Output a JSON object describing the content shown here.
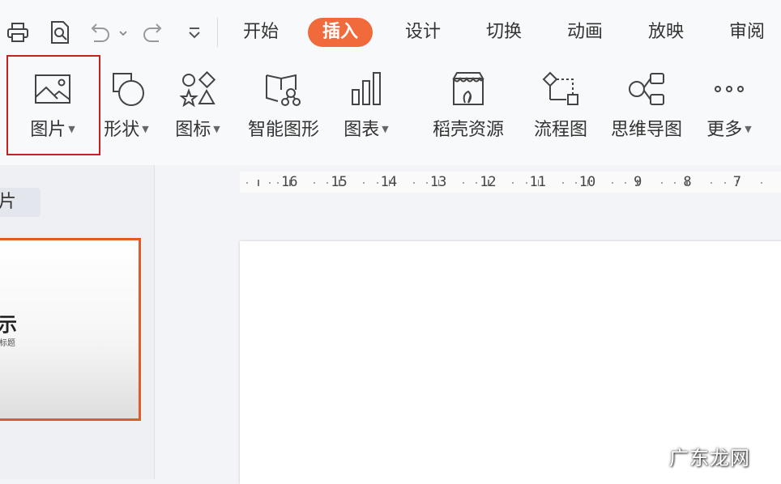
{
  "menu": {
    "tabs": [
      {
        "label": "开始",
        "active": false
      },
      {
        "label": "插入",
        "active": true
      },
      {
        "label": "设计",
        "active": false
      },
      {
        "label": "切换",
        "active": false
      },
      {
        "label": "动画",
        "active": false
      },
      {
        "label": "放映",
        "active": false
      },
      {
        "label": "审阅",
        "active": false
      }
    ]
  },
  "quick_access": [
    "print-icon",
    "print-preview-icon",
    "undo-icon",
    "redo-icon",
    "customize-dropdown-icon"
  ],
  "ribbon": {
    "items": [
      {
        "label": "图片",
        "icon": "picture-icon",
        "dropdown": true,
        "highlighted": true
      },
      {
        "label": "形状",
        "icon": "shapes-icon",
        "dropdown": true
      },
      {
        "label": "图标",
        "icon": "icons-icon",
        "dropdown": true
      },
      {
        "label": "智能图形",
        "icon": "smartart-icon",
        "dropdown": false
      },
      {
        "label": "图表",
        "icon": "chart-icon",
        "dropdown": true
      },
      {
        "label": "稻壳资源",
        "icon": "docer-resources-icon",
        "dropdown": false
      },
      {
        "label": "流程图",
        "icon": "flowchart-icon",
        "dropdown": false
      },
      {
        "label": "思维导图",
        "icon": "mindmap-icon",
        "dropdown": false
      },
      {
        "label": "更多",
        "icon": "more-icon",
        "dropdown": true
      }
    ]
  },
  "sidebar": {
    "tab_label": "幻灯片",
    "thumbnail": {
      "title": "演示",
      "subtitle": "副标题"
    }
  },
  "ruler": {
    "numbers": [
      "16",
      "15",
      "14",
      "13",
      "12",
      "11",
      "10",
      "9",
      "8",
      "7"
    ]
  },
  "watermark": "广东龙网",
  "colors": {
    "accent": "#f06a3c",
    "highlight_border": "#c8201e",
    "thumbnail_border": "#e05a2a"
  }
}
